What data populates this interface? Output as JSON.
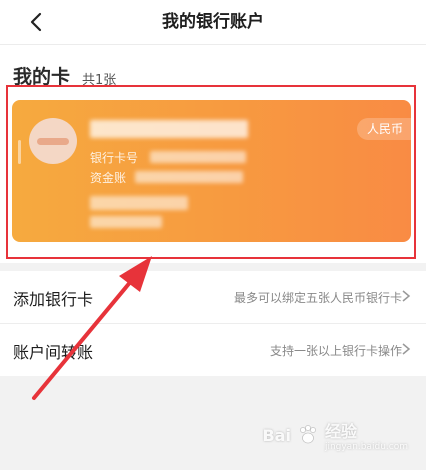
{
  "header": {
    "title": "我的银行账户",
    "back_icon": "chevron-left-icon"
  },
  "cards_section": {
    "title": "我的卡",
    "count": "共1张",
    "card": {
      "currency": "人民币",
      "card_no_label": "银行卡号",
      "fund_label": "资金账",
      "gradient_start": "#f6aa3f",
      "gradient_end": "#f98b44"
    }
  },
  "list": [
    {
      "title": "添加银行卡",
      "desc": "最多可以绑定五张人民币银行卡"
    },
    {
      "title": "账户间转账",
      "desc": "支持一张以上银行卡操作"
    }
  ],
  "annotation": {
    "highlight_color": "#e7333a",
    "arrow_color": "#e7333a"
  },
  "watermark": {
    "text": "Bai",
    "text2": "经验",
    "sub": "jingyan.baidu.com"
  }
}
